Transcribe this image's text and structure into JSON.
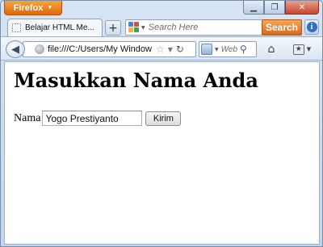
{
  "titlebar": {
    "menu_label": "Firefox",
    "minimize_symbol": "▁",
    "restore_symbol": "❐",
    "close_symbol": "✕"
  },
  "tabs": [
    {
      "label": "Belajar HTML Me..."
    }
  ],
  "newtab_symbol": "+",
  "search": {
    "placeholder": "Search Here",
    "button_label": "Search",
    "info_symbol": "i",
    "accent_color": "#e0680c"
  },
  "navbar": {
    "url": "file:///C:/Users/My Window",
    "web_search_placeholder": "Web",
    "icons": [
      "back-arrow-icon",
      "globe-icon",
      "star-icon",
      "reload-icon",
      "search-engine-icon",
      "magnifier-icon",
      "home-icon",
      "bookmarks-icon"
    ]
  },
  "page": {
    "title": "Masukkan Nama Anda",
    "form": {
      "name_label": "Nama",
      "name_value": "Yogo Prestiyanto",
      "submit_label": "Kirim"
    }
  }
}
